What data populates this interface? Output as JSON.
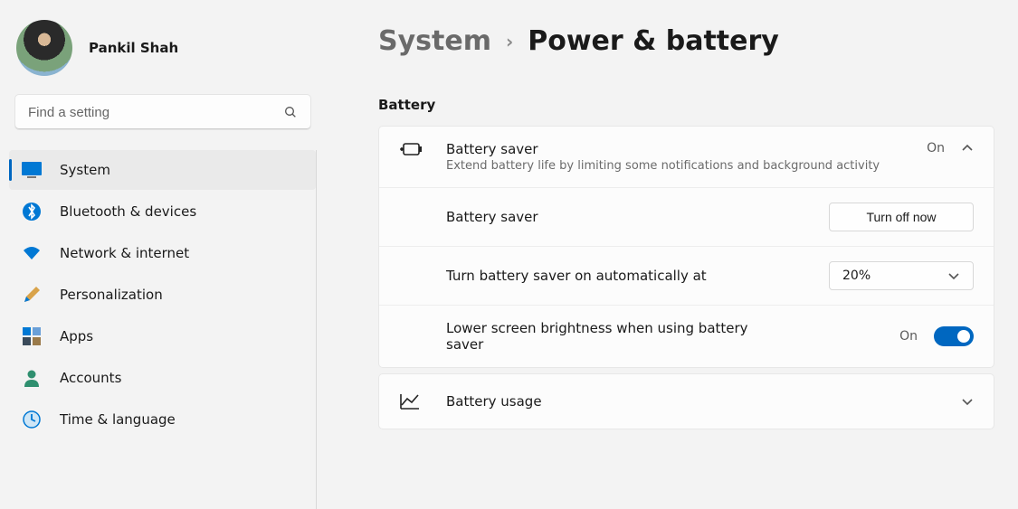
{
  "user": {
    "name": "Pankil Shah"
  },
  "search": {
    "placeholder": "Find a setting"
  },
  "sidebar": {
    "items": [
      {
        "label": "System"
      },
      {
        "label": "Bluetooth & devices"
      },
      {
        "label": "Network & internet"
      },
      {
        "label": "Personalization"
      },
      {
        "label": "Apps"
      },
      {
        "label": "Accounts"
      },
      {
        "label": "Time & language"
      }
    ]
  },
  "breadcrumb": {
    "parent": "System",
    "current": "Power & battery"
  },
  "section": {
    "label": "Battery"
  },
  "batterySaver": {
    "title": "Battery saver",
    "subtitle": "Extend battery life by limiting some notifications and background activity",
    "status": "On",
    "row1": {
      "label": "Battery saver",
      "button": "Turn off now"
    },
    "row2": {
      "label": "Turn battery saver on automatically at",
      "value": "20%"
    },
    "row3": {
      "label": "Lower screen brightness when using battery saver",
      "status": "On"
    }
  },
  "batteryUsage": {
    "title": "Battery usage"
  }
}
